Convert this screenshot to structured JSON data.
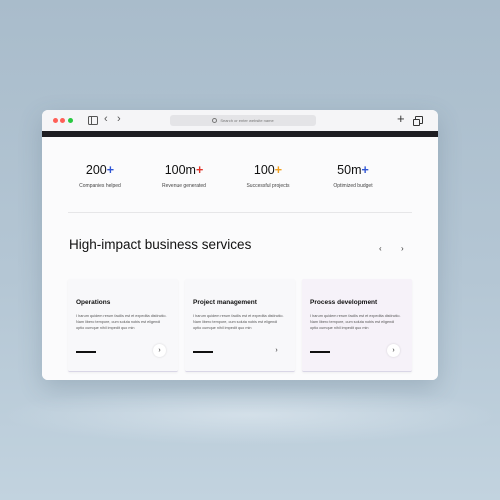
{
  "browser": {
    "url_placeholder": "Search or enter website name",
    "back_label": "‹",
    "forward_label": "›",
    "new_tab_label": "+"
  },
  "stats": [
    {
      "value": "200",
      "suffix": "+",
      "suffix_color": "#2f55d4",
      "label": "Companies helped"
    },
    {
      "value": "100m",
      "suffix": "+",
      "suffix_color": "#e0352b",
      "label": "Revenue generated"
    },
    {
      "value": "100",
      "suffix": "+",
      "suffix_color": "#f0a020",
      "label": "Successful projects"
    },
    {
      "value": "50m",
      "suffix": "+",
      "suffix_color": "#2f55d4",
      "label": "Optimized budget"
    }
  ],
  "services": {
    "title": "High-impact business services",
    "prev_label": "‹",
    "next_label": "›",
    "cards": [
      {
        "title": "Operations",
        "text": "I harum quidem rerum facilis est et expedita distinctio. Nam libero tempore, cum soluta nobis est eligendi optio cumque nihil impedit quo min",
        "arrow": "›"
      },
      {
        "title": "Project management",
        "text": "I harum quidem rerum facilis est et expedita distinctio. Nam libero tempore, cum soluta nobis est eligendi optio cumque nihil impedit quo min",
        "arrow": "›"
      },
      {
        "title": "Process development",
        "text": "I harum quidem rerum facilis est et expedita distinctio. Nam libero tempore, cum soluta nobis est eligendi optio cumque nihil impedit quo min",
        "arrow": "›"
      }
    ]
  }
}
